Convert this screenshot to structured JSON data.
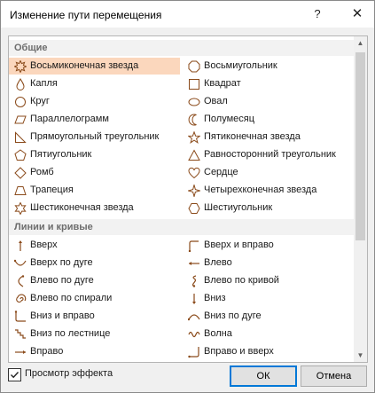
{
  "window": {
    "title": "Изменение пути перемещения",
    "help_glyph": "?",
    "close_glyph": "✕"
  },
  "accent": {
    "selected_bg": "#fbd7bd",
    "icon_color": "#8a4a1a",
    "ok_border": "#0078d7"
  },
  "groups": [
    {
      "title": "Общие",
      "items": [
        {
          "label": "Восьмиконечная звезда",
          "icon": "eight-point-star-icon",
          "selected": true
        },
        {
          "label": "Восьмиугольник",
          "icon": "octagon-icon"
        },
        {
          "label": "Капля",
          "icon": "drop-icon"
        },
        {
          "label": "Квадрат",
          "icon": "square-icon"
        },
        {
          "label": "Круг",
          "icon": "circle-icon"
        },
        {
          "label": "Овал",
          "icon": "oval-icon"
        },
        {
          "label": "Параллелограмм",
          "icon": "parallelogram-icon"
        },
        {
          "label": "Полумесяц",
          "icon": "crescent-icon"
        },
        {
          "label": "Прямоугольный треугольник",
          "icon": "right-triangle-icon"
        },
        {
          "label": "Пятиконечная звезда",
          "icon": "five-point-star-icon"
        },
        {
          "label": "Пятиугольник",
          "icon": "pentagon-icon"
        },
        {
          "label": "Равносторонний треугольник",
          "icon": "equilateral-triangle-icon"
        },
        {
          "label": "Ромб",
          "icon": "diamond-icon"
        },
        {
          "label": "Сердце",
          "icon": "heart-icon"
        },
        {
          "label": "Трапеция",
          "icon": "trapezoid-icon"
        },
        {
          "label": "Четырехконечная звезда",
          "icon": "four-point-star-icon"
        },
        {
          "label": "Шестиконечная звезда",
          "icon": "six-point-star-icon"
        },
        {
          "label": "Шестиугольник",
          "icon": "hexagon-icon"
        }
      ]
    },
    {
      "title": "Линии и кривые",
      "items": [
        {
          "label": "Вверх",
          "icon": "line-up-icon"
        },
        {
          "label": "Вверх и вправо",
          "icon": "up-right-icon"
        },
        {
          "label": "Вверх по дуге",
          "icon": "arc-up-icon"
        },
        {
          "label": "Влево",
          "icon": "line-left-icon"
        },
        {
          "label": "Влево по дуге",
          "icon": "arc-left-icon"
        },
        {
          "label": "Влево по кривой",
          "icon": "curve-left-icon"
        },
        {
          "label": "Влево по спирали",
          "icon": "spiral-left-icon"
        },
        {
          "label": "Вниз",
          "icon": "line-down-icon"
        },
        {
          "label": "Вниз и вправо",
          "icon": "down-right-icon"
        },
        {
          "label": "Вниз по дуге",
          "icon": "arc-down-icon"
        },
        {
          "label": "Вниз по лестнице",
          "icon": "stairs-down-icon"
        },
        {
          "label": "Волна",
          "icon": "wave-icon"
        },
        {
          "label": "Вправо",
          "icon": "line-right-icon"
        },
        {
          "label": "Вправо и вверх",
          "icon": "right-up-icon"
        }
      ]
    }
  ],
  "footer": {
    "preview_label": "Просмотр эффекта",
    "preview_checked": true,
    "ok_label": "ОК",
    "cancel_label": "Отмена"
  },
  "scrollbar": {
    "up_glyph": "▲",
    "down_glyph": "▼"
  }
}
